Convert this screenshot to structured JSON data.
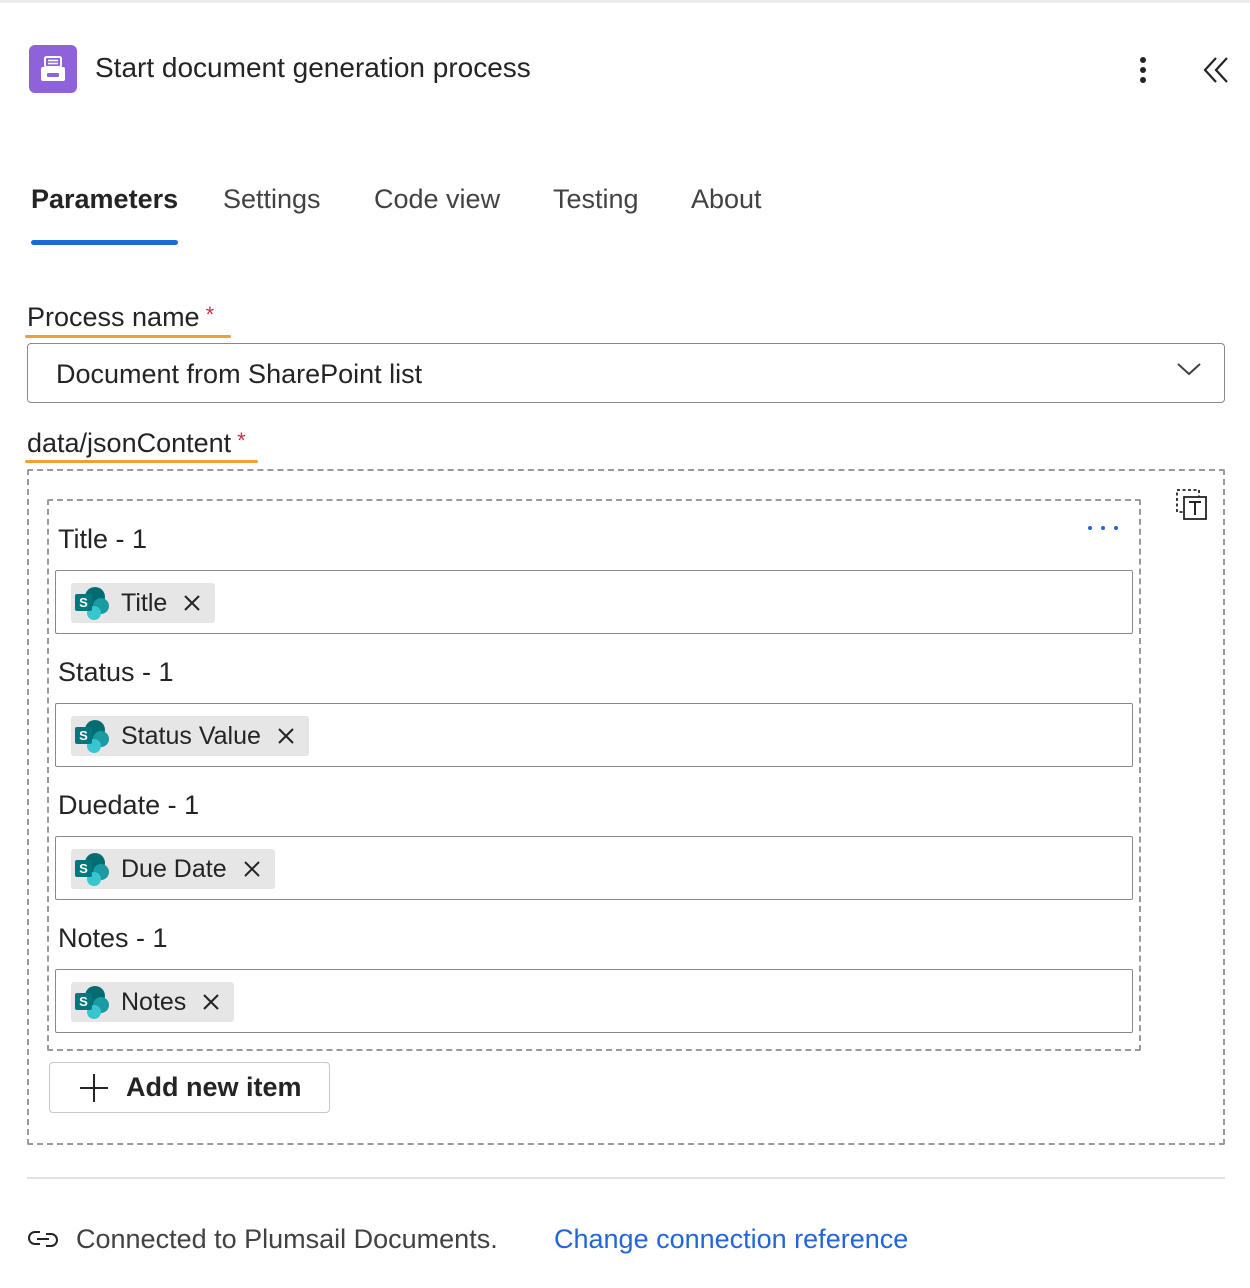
{
  "header": {
    "title": "Start document generation process",
    "icon": "document-printer-icon",
    "icon_color": "#8e62d9"
  },
  "tabs": [
    {
      "label": "Parameters",
      "active": true
    },
    {
      "label": "Settings",
      "active": false
    },
    {
      "label": "Code view",
      "active": false
    },
    {
      "label": "Testing",
      "active": false
    },
    {
      "label": "About",
      "active": false
    }
  ],
  "process_name": {
    "label": "Process name",
    "required_mark": "*",
    "value": "Document from SharePoint list"
  },
  "json_content": {
    "label": "data/jsonContent",
    "required_mark": "*",
    "items": [
      {
        "label": "Title - 1",
        "token": "Title"
      },
      {
        "label": "Status - 1",
        "token": "Status Value"
      },
      {
        "label": "Duedate - 1",
        "token": "Due Date"
      },
      {
        "label": "Notes - 1",
        "token": "Notes"
      }
    ],
    "add_label": "Add new item"
  },
  "footer": {
    "connection_text": "Connected to Plumsail Documents.",
    "change_link": "Change connection reference"
  },
  "colors": {
    "accent": "#2266d8",
    "label_underline": "#f0a030",
    "required": "#c4314b",
    "sharepoint": "#038387"
  }
}
